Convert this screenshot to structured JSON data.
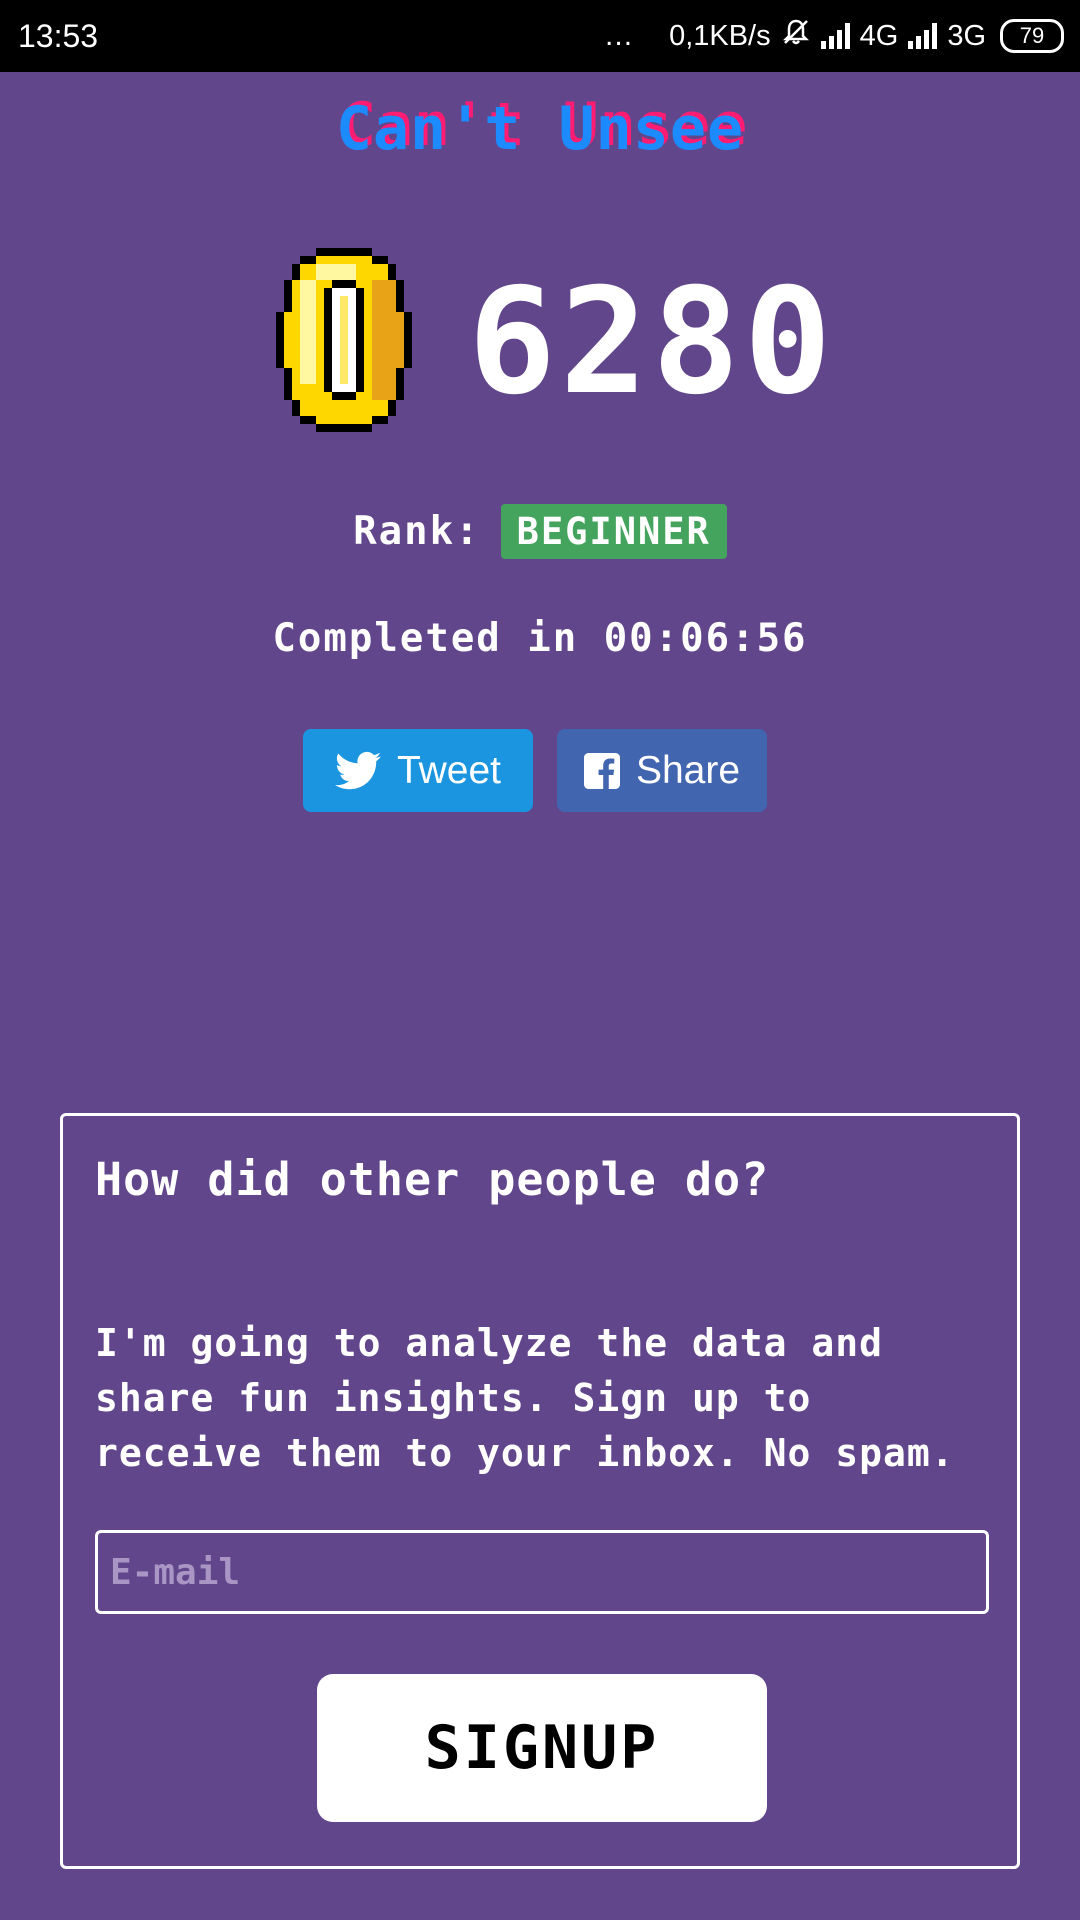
{
  "status_bar": {
    "time": "13:53",
    "dots": "...",
    "speed": "0,1KB/s",
    "network_1": "4G",
    "network_2": "3G",
    "battery": "79",
    "icons": [
      "mute-bell-icon",
      "signal-icon",
      "signal-icon",
      "battery-icon"
    ]
  },
  "game": {
    "title": "Can't Unsee",
    "score": "6280",
    "score_icon": "coin-icon",
    "rank_label": "Rank:",
    "rank_value": "BEGINNER",
    "completed_text": "Completed in 00:06:56"
  },
  "share": {
    "tweet_label": "Tweet",
    "tweet_icon": "twitter-bird-icon",
    "share_label": "Share",
    "share_icon": "facebook-icon"
  },
  "signup": {
    "heading": "How did other people do?",
    "body": "I'm going to analyze the data and share fun insights. Sign up to receive them to your inbox. No spam.",
    "email_placeholder": "E-mail",
    "button_label": "SIGNUP"
  },
  "colors": {
    "background": "#62468c",
    "title_blue": "#1b8bff",
    "title_pink": "#ff1c72",
    "rank_badge": "#44a35c",
    "twitter": "#1b95e0",
    "facebook": "#4265b0",
    "coin_yellow": "#ffd700"
  }
}
